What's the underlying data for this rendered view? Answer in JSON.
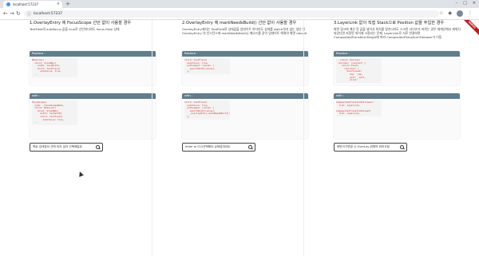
{
  "browser": {
    "tab_title": "localhost:57237",
    "new_tab": "+",
    "close": "×",
    "url": "localhost:57237",
    "ribbon": "DEBUG"
  },
  "columns": [
    {
      "title": "1.OverlayEntry 에 FocusScope 선언 없이 사용할 경우",
      "desc": "TextField의 autofocus 값을 true로 선언하더라도 focus false 상태",
      "replace_header": "Replace :",
      "replace_code": "Material(\n  child: SizedBox(\n    width: textWidth,\n    child: TextField(\n      autofocus: true,\n ...",
      "with_header": "with :",
      "with_code": "FocusScope(\n  node: _focusScopeNode,\n  child: Material(\n    child: SizedBox(\n      width: textWidth,\n      child: TextField(\n        autofocus: true,\n ...",
      "search_text": "목로 검색창이 선택 되지 않아 선택해일요"
    },
    {
      "title": "2.OverlayEntry 에 markNeedsBuild() 선언 없이 사용할 경우",
      "desc": "OverlayEntry에서는 TextField로 상태값을 업데이트 하더라도 상태를 watch하지 않는 생은 된 OverlayEntry 의 인스턴스에 markNeedsBuild() 메소드를 같이 업데이트 해줘야 화면 rebuild",
      "replace_header": "Replace :",
      "replace_code": "child: TextField(\n  autofocus: true,\n  onChanged: (value) {\n    searchWidth(value);\n  },",
      "with_header": "with :",
      "with_code": "child: TextField(\n  autofocus: true,\n  onChanged: (value) {\n    searchWidth(value);\n    _overlayEntry.markNeedsBuild();\n  },",
      "search_text": "enter or 다시선택해야 상태업데이트"
    },
    {
      "title": "3.LayerLink 없이 직접 Stack으로 Position 값을 주입한 경우",
      "desc": "화면 링크에 계산 된 값을 넣어서 위치를 맞추더라도 스크린 사이즈가 바뀌는 경우 재계산해서 재위치 되었다면 지정된 위치에 고정되는 문제. LayerLink로 서로 연결하면 CompositedTransformTarget에 따라 CompositedTransformFollower가 이동",
      "replace_header": "Replace :",
      "replace_code": "...return Overlay(\n  builder: (context) {\n    return Stack(\n      children: [\n        Positioned(\n          top: _top,\n          left: _left,\n          child:",
      "with_header": "with :",
      "with_code": "CompositedTransformFollower(\n  link: layerLink,\n\nCompositedTransformTarget(\n  link: layerLink,",
      "search_text": "화면크기변경 시 OverLay 위젯의 위치고정"
    }
  ]
}
